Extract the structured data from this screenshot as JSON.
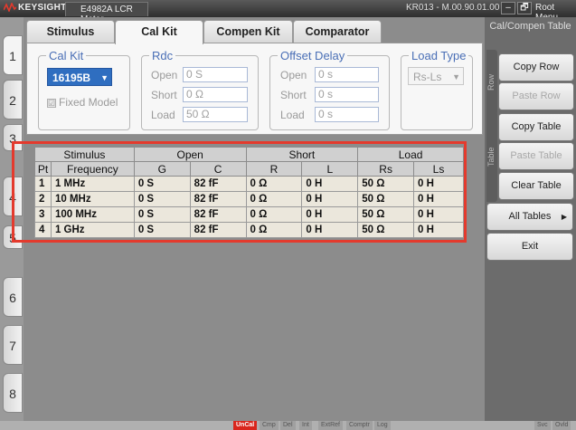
{
  "titlebar": {
    "brand": "KEYSIGHT",
    "app_tab": "E4982A LCR Meter",
    "serial": "KR013 - M.00.90.01.00",
    "min_icon": "–",
    "restore_icon": "🗗",
    "root_menu": "Root Menu"
  },
  "left_tabs": [
    "1",
    "2",
    "3",
    "4",
    "5",
    "6",
    "7",
    "8"
  ],
  "tabs": [
    "Stimulus",
    "Cal Kit",
    "Compen Kit",
    "Comparator"
  ],
  "cal_kit": {
    "legend": "Cal Kit",
    "selected": "16195B",
    "fixed_model_label": "Fixed Model"
  },
  "rdc": {
    "legend": "Rdc",
    "open_label": "Open",
    "open_value": "0 S",
    "short_label": "Short",
    "short_value": "0 Ω",
    "load_label": "Load",
    "load_value": "50 Ω"
  },
  "offset_delay": {
    "legend": "Offset Delay",
    "open_label": "Open",
    "open_value": "0 s",
    "short_label": "Short",
    "short_value": "0 s",
    "load_label": "Load",
    "load_value": "0 s"
  },
  "load_type": {
    "legend": "Load Type",
    "selected": "Rs-Ls"
  },
  "table": {
    "group_headers": [
      "Stimulus",
      "Open",
      "Short",
      "Load"
    ],
    "columns": [
      "Pt",
      "Frequency",
      "G",
      "C",
      "R",
      "L",
      "Rs",
      "Ls"
    ],
    "rows": [
      [
        "1",
        "1 MHz",
        "0 S",
        "82 fF",
        "0 Ω",
        "0 H",
        "50 Ω",
        "0 H"
      ],
      [
        "2",
        "10 MHz",
        "0 S",
        "82 fF",
        "0 Ω",
        "0 H",
        "50 Ω",
        "0 H"
      ],
      [
        "3",
        "100 MHz",
        "0 S",
        "82 fF",
        "0 Ω",
        "0 H",
        "50 Ω",
        "0 H"
      ],
      [
        "4",
        "1 GHz",
        "0 S",
        "82 fF",
        "0 Ω",
        "0 H",
        "50 Ω",
        "0 H"
      ]
    ]
  },
  "right_panel": {
    "title": "Cal/Compen Table",
    "row_label": "Row",
    "table_label": "Table",
    "copy_row": "Copy Row",
    "paste_row": "Paste Row",
    "copy_table": "Copy Table",
    "paste_table": "Paste Table",
    "clear_table": "Clear Table",
    "all_tables": "All Tables",
    "all_tables_arrow": "▶",
    "exit": "Exit"
  },
  "status": [
    "UnCal",
    "Cmp",
    "Del",
    "Int",
    "ExtRef",
    "Comptr",
    "Log",
    "Svc",
    "Ovld"
  ],
  "colors": {
    "highlight": "#e43a2d",
    "accent": "#2f6ec0"
  }
}
